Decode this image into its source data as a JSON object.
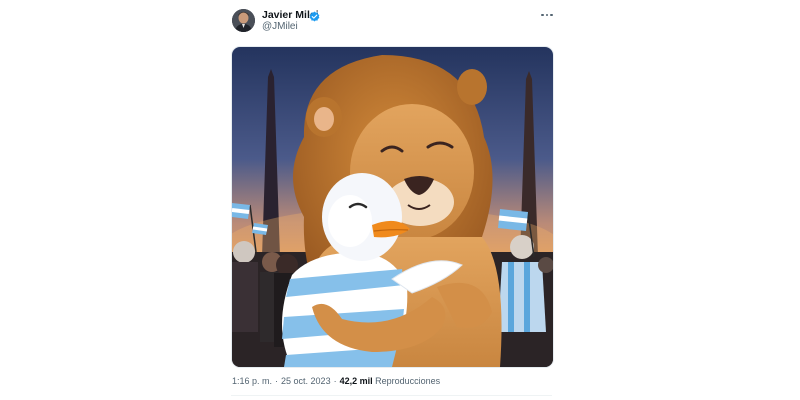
{
  "tweet": {
    "author": {
      "name": "Javier Milei",
      "handle": "@JMilei",
      "verified_icon": "verified-badge-icon",
      "verified_color": "#1d9bf0"
    },
    "more_icon": "more-options-icon",
    "media_alt": "Ilustración de un león abrazando a un pato con bandera argentina",
    "meta": {
      "time": "1:16 p. m.",
      "separator": "·",
      "date": "25 oct. 2023",
      "views_count": "42,2 mil",
      "views_label": "Reproducciones"
    },
    "colors": {
      "text_primary": "#0f1419",
      "text_secondary": "#536471",
      "divider": "#eff3f4"
    }
  }
}
